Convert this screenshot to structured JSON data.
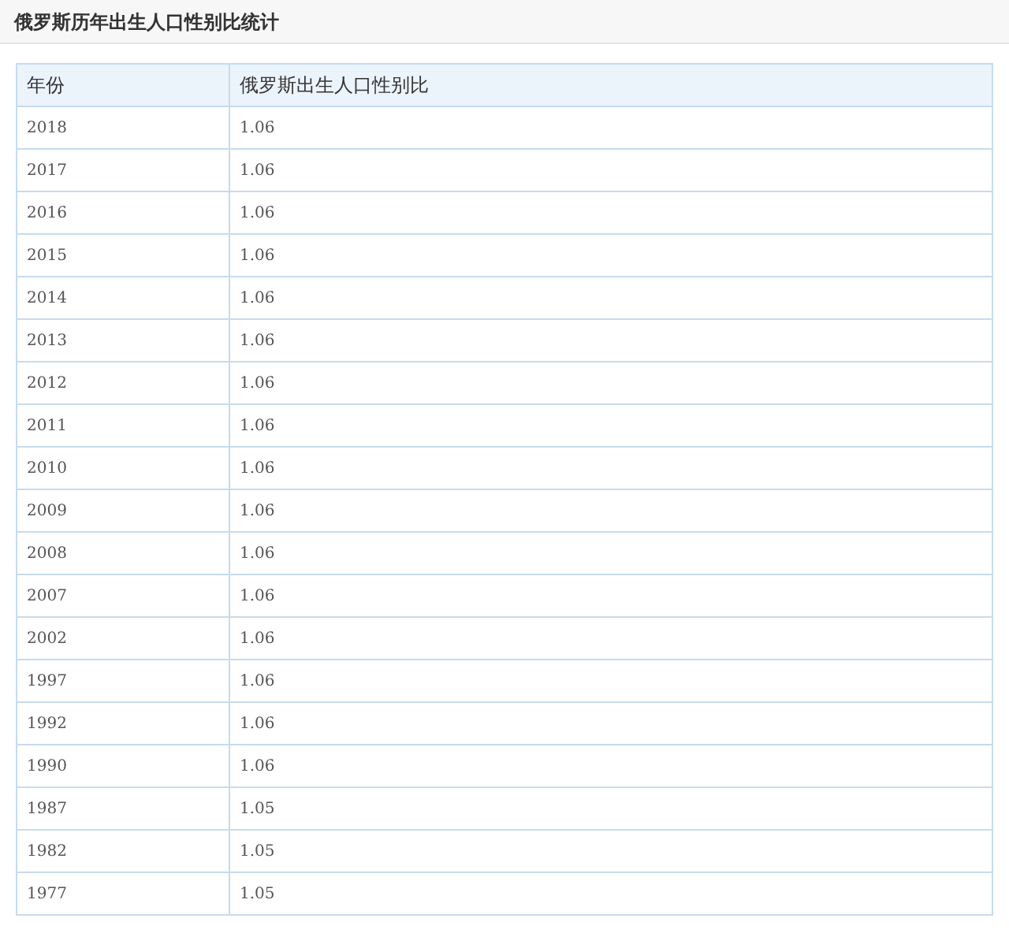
{
  "title": "俄罗斯历年出生人口性别比统计",
  "table": {
    "columns": [
      "年份",
      "俄罗斯出生人口性别比"
    ],
    "rows": [
      [
        "2018",
        "1.06"
      ],
      [
        "2017",
        "1.06"
      ],
      [
        "2016",
        "1.06"
      ],
      [
        "2015",
        "1.06"
      ],
      [
        "2014",
        "1.06"
      ],
      [
        "2013",
        "1.06"
      ],
      [
        "2012",
        "1.06"
      ],
      [
        "2011",
        "1.06"
      ],
      [
        "2010",
        "1.06"
      ],
      [
        "2009",
        "1.06"
      ],
      [
        "2008",
        "1.06"
      ],
      [
        "2007",
        "1.06"
      ],
      [
        "2002",
        "1.06"
      ],
      [
        "1997",
        "1.06"
      ],
      [
        "1992",
        "1.06"
      ],
      [
        "1990",
        "1.06"
      ],
      [
        "1987",
        "1.05"
      ],
      [
        "1982",
        "1.05"
      ],
      [
        "1977",
        "1.05"
      ]
    ]
  }
}
